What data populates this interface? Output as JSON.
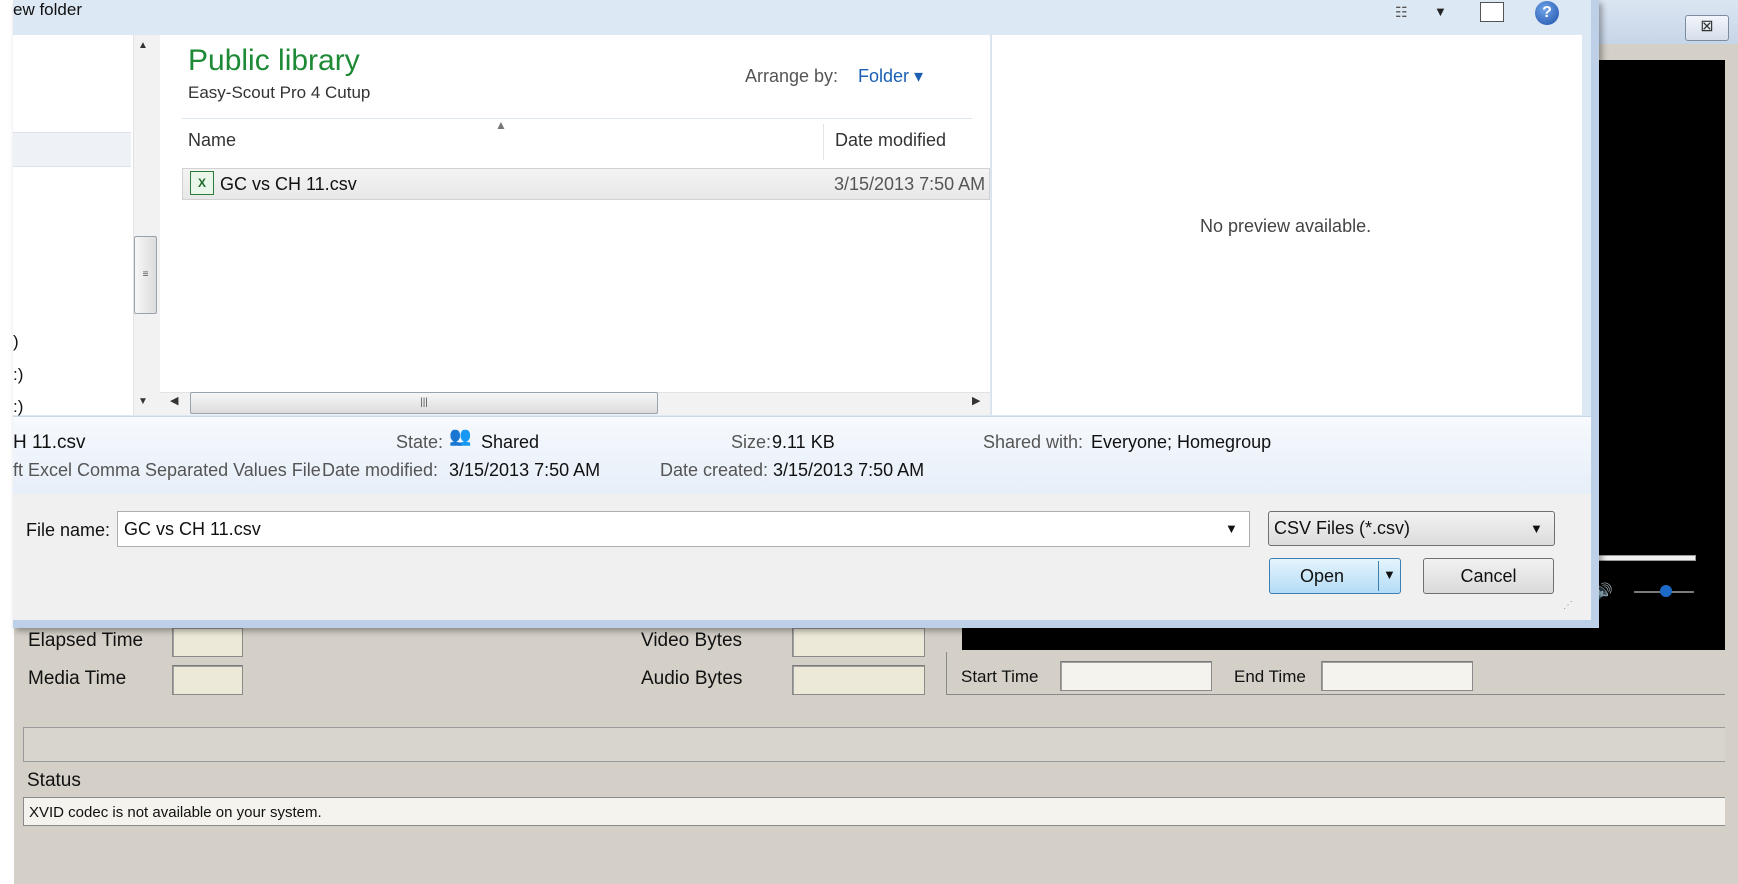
{
  "dialog": {
    "title": "ew folder",
    "library_title": "Public library",
    "library_subtitle": "Easy-Scout Pro 4 Cutup",
    "arrange_label": "Arrange by:",
    "arrange_value": "Folder ▾",
    "columns": {
      "name": "Name",
      "date": "Date modified"
    },
    "file": {
      "name": "GC vs CH 11.csv",
      "date": "3/15/2013 7:50 AM",
      "icon": "excel-csv-icon"
    },
    "preview": "No preview available.",
    "nav_drives": [
      ")",
      ":)",
      ":)"
    ],
    "details": {
      "filename": "H 11.csv",
      "filetype": "ft Excel Comma Separated Values File",
      "state_label": "State:",
      "state_value": "Shared",
      "size_label": "Size:",
      "size_value": "9.11 KB",
      "shared_label": "Shared with:",
      "shared_value": "Everyone; Homegroup",
      "modified_label": "Date modified:",
      "modified_value": "3/15/2013 7:50 AM",
      "created_label": "Date created:",
      "created_value": "3/15/2013 7:50 AM"
    },
    "filename_label": "File name:",
    "filename_value": "GC vs CH 11.csv",
    "filetype_selected": "CSV Files (*.csv)",
    "open_label": "Open",
    "cancel_label": "Cancel"
  },
  "app": {
    "close_glyph": "⊠",
    "elapsed_label": "Elapsed Time",
    "media_label": "Media Time",
    "video_bytes_label": "Video Bytes",
    "audio_bytes_label": "Audio Bytes",
    "start_label": "Start Time",
    "end_label": "End Time",
    "status_label": "Status",
    "status_text": "XVID codec is not available on your system."
  }
}
